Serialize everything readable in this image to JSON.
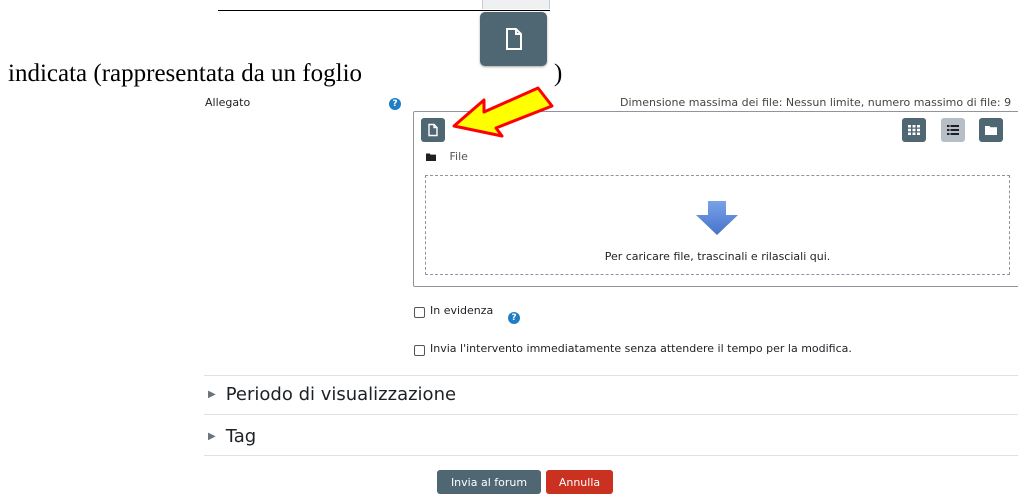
{
  "document": {
    "sentence": "indicata (rappresentata da un foglio",
    "closing": ")"
  },
  "form": {
    "attachment_label": "Allegato",
    "limits_text": "Dimensione massima dei file: Nessun limite, numero massimo di file: 9",
    "path_label": "File",
    "dropzone_text": "Per caricare file, trascinali e rilasciali qui.",
    "checkbox_highlight_label": "In evidenza",
    "checkbox_send_label": "Invia l'intervento immediatamente senza attendere il tempo per la modifica."
  },
  "sections": [
    {
      "label": "Periodo di visualizzazione"
    },
    {
      "label": "Tag"
    }
  ],
  "buttons": {
    "submit_label": "Invia al forum",
    "cancel_label": "Annulla"
  },
  "icons": {
    "add_file": "file-icon",
    "view_grid": "grid-icon",
    "view_list": "list-icon",
    "view_tree": "folder-icon",
    "help": "question-icon",
    "arrow_annotation": "arrow-pointer-icon",
    "download": "arrow-down-icon"
  },
  "colors": {
    "primary_button": "#4f6673",
    "active_toggle": "#b7bec5",
    "help": "#1f7ec4",
    "danger": "#ca3120",
    "annotation_fill": "#ffff00",
    "annotation_stroke": "#ff0000",
    "arrow_blue": "#5b86d8"
  }
}
